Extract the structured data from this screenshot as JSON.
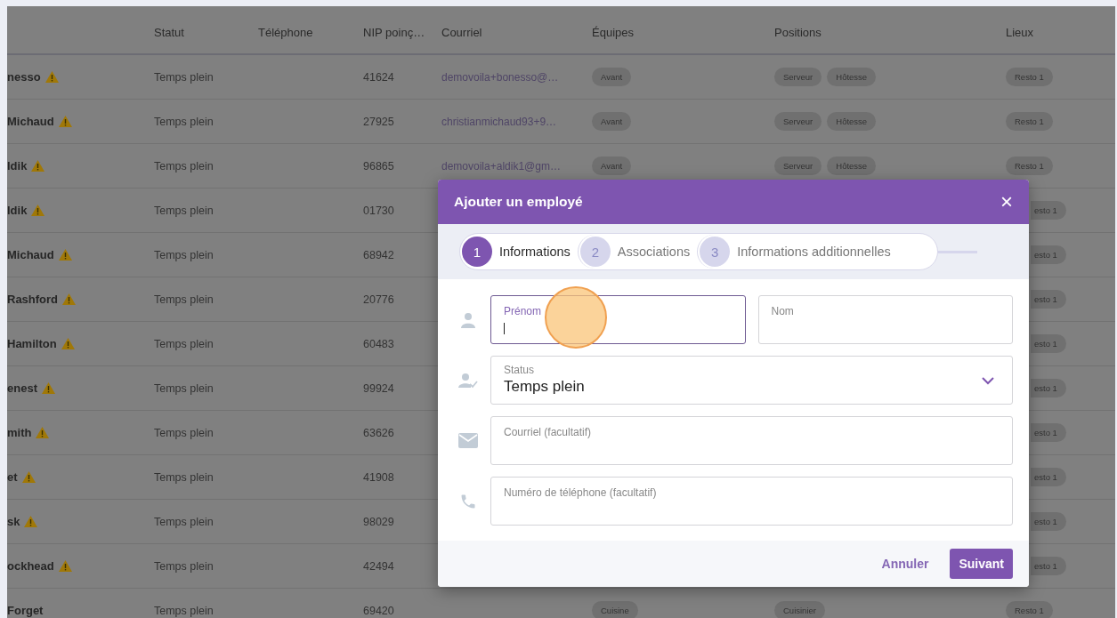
{
  "table": {
    "columns": [
      "Statut",
      "Téléphone",
      "NIP poinç…",
      "Courriel",
      "Équipes",
      "Positions",
      "Lieux"
    ],
    "rows": [
      {
        "kind": "full",
        "name": "nesso",
        "warning": true,
        "statut": "Temps plein",
        "nip": "41624",
        "courriel": "demovoila+bonesso@…",
        "equipes": [
          "Avant"
        ],
        "positions": [
          "Serveur",
          "Hôtesse"
        ],
        "lieux": [
          "Resto 1"
        ]
      },
      {
        "kind": "full",
        "name": "Michaud",
        "warning": true,
        "statut": "Temps plein",
        "nip": "27925",
        "courriel": "christianmichaud93+9…",
        "equipes": [
          "Avant"
        ],
        "positions": [
          "Serveur",
          "Hôtesse"
        ],
        "lieux": [
          "Resto 1"
        ]
      },
      {
        "kind": "full",
        "name": "ldik",
        "warning": true,
        "statut": "Temps plein",
        "nip": "96865",
        "courriel": "demovoila+aldik1@gm…",
        "equipes": [
          "Avant"
        ],
        "positions": [
          "Serveur",
          "Hôtesse"
        ],
        "lieux": [
          "Resto 1"
        ]
      },
      {
        "kind": "covered",
        "name": "ldik",
        "warning": true,
        "statut": "Temps plein",
        "nip": "01730",
        "lieux": [
          "esto 1"
        ]
      },
      {
        "kind": "covered",
        "name": "Michaud",
        "warning": true,
        "statut": "Temps plein",
        "nip": "68942",
        "lieux": [
          "esto 1"
        ]
      },
      {
        "kind": "covered",
        "name": "Rashford",
        "warning": true,
        "statut": "Temps plein",
        "nip": "20776",
        "lieux": [
          "esto 1"
        ]
      },
      {
        "kind": "covered",
        "name": "Hamilton",
        "warning": true,
        "statut": "Temps plein",
        "nip": "60483",
        "lieux": [
          "esto 1"
        ]
      },
      {
        "kind": "covered",
        "name": "enest",
        "warning": true,
        "statut": "Temps plein",
        "nip": "99924",
        "lieux": [
          "esto 1"
        ]
      },
      {
        "kind": "covered",
        "name": "mith",
        "warning": true,
        "statut": "Temps plein",
        "nip": "63626",
        "lieux": [
          "esto 1"
        ]
      },
      {
        "kind": "covered",
        "name": "et",
        "warning": true,
        "statut": "Temps plein",
        "nip": "41908",
        "lieux": [
          "esto 1"
        ]
      },
      {
        "kind": "covered",
        "name": "sk",
        "warning": true,
        "statut": "Temps plein",
        "nip": "98029",
        "lieux": [
          "esto 1"
        ]
      },
      {
        "kind": "covered",
        "name": "ockhead",
        "warning": true,
        "statut": "Temps plein",
        "nip": "42494",
        "lieux": [
          "esto 1"
        ]
      },
      {
        "kind": "full",
        "name": "Forget",
        "warning": false,
        "statut": "Temps plein",
        "nip": "69420",
        "equipes": [
          "Cuisine"
        ],
        "positions": [
          "Cuisinier"
        ],
        "lieux": [
          "Resto 1"
        ]
      }
    ]
  },
  "dialog": {
    "title": "Ajouter un employé",
    "close": "×",
    "steps": [
      {
        "number": "1",
        "label": "Informations",
        "selected": true
      },
      {
        "number": "2",
        "label": "Associations",
        "selected": false
      },
      {
        "number": "3",
        "label": "Informations additionnelles",
        "selected": false
      }
    ],
    "fields": [
      {
        "kind": "name-pair",
        "items": [
          {
            "placeholder": "Prénom",
            "focused": true
          },
          {
            "placeholder": "Nom",
            "focused": false
          }
        ]
      },
      {
        "kind": "select",
        "label": "Status",
        "value": "Temps plein"
      },
      {
        "kind": "text",
        "placeholder": "Courriel (facultatif)",
        "focused": false
      },
      {
        "kind": "text",
        "placeholder": "Numéro de téléphone (facultatif)",
        "focused": false
      }
    ],
    "cancel": "Annuler",
    "next": "Suivant",
    "click_marker": true
  }
}
